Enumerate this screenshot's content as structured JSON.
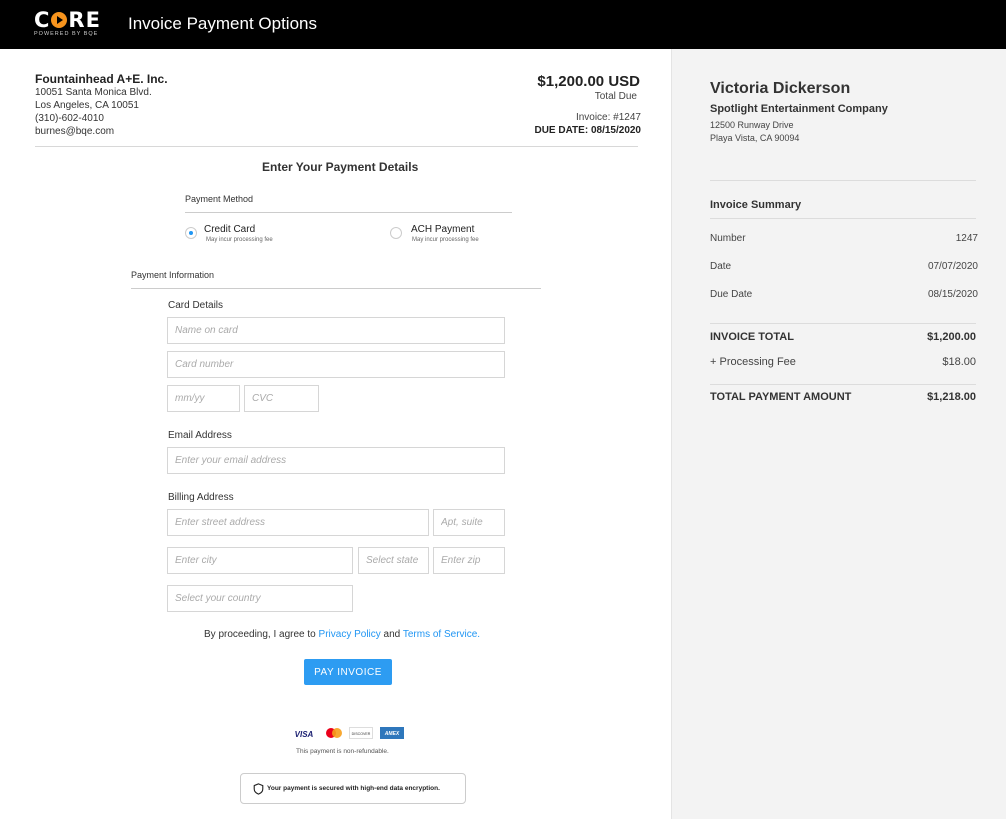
{
  "app": {
    "logo_text_c": "C",
    "logo_text_re": "RE",
    "logo_sub": "POWERED BY BQE",
    "title": "Invoice Payment Options"
  },
  "vendor": {
    "name": "Fountainhead A+E. Inc.",
    "address1": "10051 Santa Monica Blvd.",
    "address2": "Los Angeles, CA 10051",
    "phone": "(310)-602-4010",
    "email": "burnes@bqe.com"
  },
  "invoice": {
    "amount": "$1,200.00 USD",
    "total_due_label": "Total Due",
    "number_label": "Invoice: #1247",
    "due_date_label": "DUE DATE: 08/15/2020"
  },
  "form": {
    "section_title": "Enter Your Payment Details",
    "payment_method_label": "Payment Method",
    "options": [
      {
        "label": "Credit Card",
        "sub": "May incur processing fee",
        "selected": true
      },
      {
        "label": "ACH Payment",
        "sub": "May incur processing fee",
        "selected": false
      }
    ],
    "payment_info_label": "Payment Information",
    "card_details_label": "Card Details",
    "name_placeholder": "Name on card",
    "card_number_placeholder": "Card number",
    "expiry_placeholder": "mm/yy",
    "cvc_placeholder": "CVC",
    "email_label": "Email Address",
    "email_placeholder": "Enter your email address",
    "billing_label": "Billing Address",
    "street_placeholder": "Enter street address",
    "apt_placeholder": "Apt, suite",
    "city_placeholder": "Enter city",
    "state_placeholder": "Select state",
    "zip_placeholder": "Enter zip",
    "country_placeholder": "Select your country",
    "agree_prefix": "By proceeding, I agree to ",
    "privacy_link": "Privacy Policy",
    "agree_and": " and ",
    "terms_link": "Terms of Service.",
    "pay_button": "PAY INVOICE",
    "card_brands": [
      "VISA",
      "mastercard",
      "DISCOVER",
      "AMEX"
    ],
    "non_refundable": "This payment is non-refundable.",
    "secure_text": "Your payment is secured with high-end data encryption."
  },
  "client": {
    "name": "Victoria Dickerson",
    "company": "Spotlight Entertainment Company",
    "address1": "12500 Runway Drive",
    "address2": "Playa Vista, CA 90094"
  },
  "summary": {
    "title": "Invoice Summary",
    "rows": [
      {
        "label": "Number",
        "value": "1247"
      },
      {
        "label": "Date",
        "value": "07/07/2020"
      },
      {
        "label": "Due Date",
        "value": "08/15/2020"
      }
    ],
    "invoice_total_label": "INVOICE TOTAL",
    "invoice_total_value": "$1,200.00",
    "fee_label": "+ Processing Fee",
    "fee_value": "$18.00",
    "payment_total_label": "TOTAL PAYMENT AMOUNT",
    "payment_total_value": "$1,218.00"
  },
  "colors": {
    "accent": "#2d9cf2",
    "logo_orange": "#f7941d",
    "topbar": "#000000",
    "panel": "#f3f3f3"
  }
}
